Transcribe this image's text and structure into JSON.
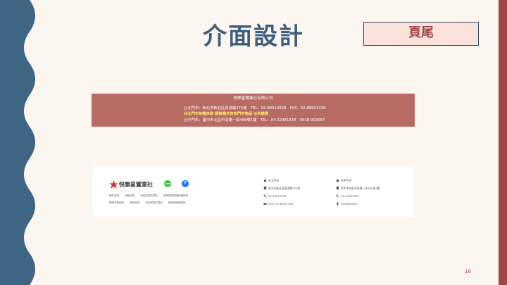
{
  "slide": {
    "title": "介面設計",
    "tag": "頁尾",
    "page_number": "16"
  },
  "footer_red": {
    "company": "快樂星實業社有限公司",
    "line1": "台北門市：新北市新莊區思源路375號　TEL：02-89919938　FAX：02-89931338",
    "line2": "台北門市如需自取 請前幾天告知門市物品 以利備貨",
    "line3": "台中門市：臺中市北區中清路一段489號1樓　TEL：04-22981838　0918-909687"
  },
  "footer_white": {
    "logo_text": "快樂星實業社",
    "social": [
      "LINE",
      "f"
    ],
    "links_row1": [
      "關於我們",
      "活動花絮",
      "商品退換貨須知",
      "會員專區與隱私權政策"
    ],
    "links_row2": [
      "購物流程說明",
      "運費說明",
      "商品退換貨須知",
      "隱私權保護政策"
    ],
    "store_a": {
      "name": "台北門市",
      "address": "新北市新莊區思源路375號",
      "phone": "02-89919938",
      "fax": "FAX: 02-89931338"
    },
    "store_b": {
      "name": "台中門市",
      "address": "台中市北區中清路一段489號1樓",
      "phone": "04-22981838",
      "mobile": "0918909687"
    }
  }
}
